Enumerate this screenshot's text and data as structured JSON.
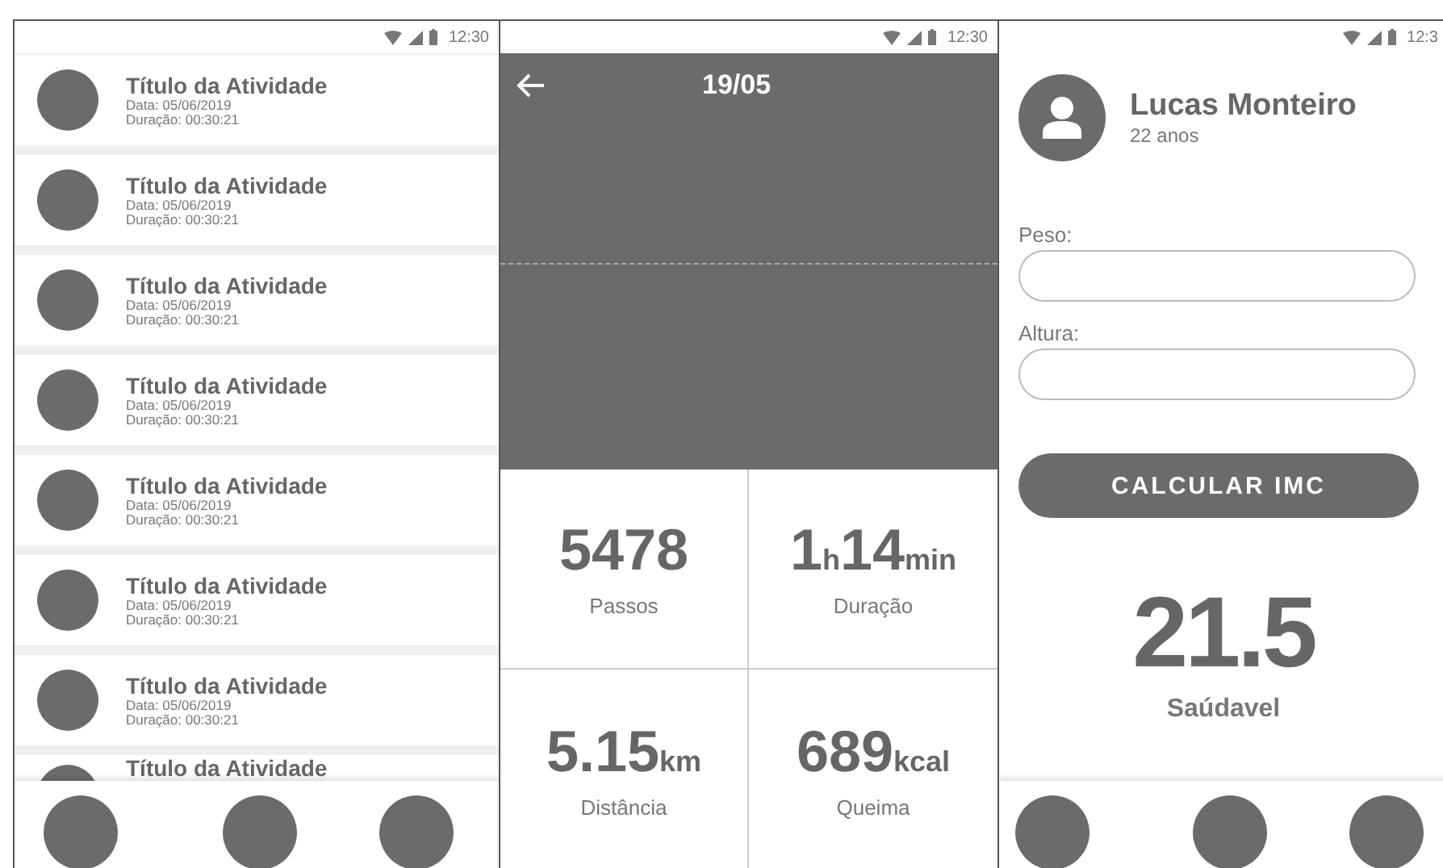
{
  "status_bars": [
    {
      "time": "12:30"
    },
    {
      "time": "12:30"
    },
    {
      "time": "12:3"
    }
  ],
  "activity_list": {
    "items": [
      {
        "title": "Título da Atividade",
        "date": "Data: 05/06/2019",
        "duration": "Duração: 00:30:21"
      },
      {
        "title": "Título da Atividade",
        "date": "Data: 05/06/2019",
        "duration": "Duração: 00:30:21"
      },
      {
        "title": "Título da Atividade",
        "date": "Data: 05/06/2019",
        "duration": "Duração: 00:30:21"
      },
      {
        "title": "Título da Atividade",
        "date": "Data: 05/06/2019",
        "duration": "Duração: 00:30:21"
      },
      {
        "title": "Título da Atividade",
        "date": "Data: 05/06/2019",
        "duration": "Duração: 00:30:21"
      },
      {
        "title": "Título da Atividade",
        "date": "Data: 05/06/2019",
        "duration": "Duração: 00:30:21"
      },
      {
        "title": "Título da Atividade",
        "date": "Data: 05/06/2019",
        "duration": "Duração: 00:30:21"
      },
      {
        "title": "Título da Atividade"
      }
    ]
  },
  "activity_detail": {
    "title": "19/05",
    "stats": [
      {
        "parts": [
          {
            "kind": "number",
            "text": "5478"
          }
        ],
        "label": "Passos"
      },
      {
        "parts": [
          {
            "kind": "number",
            "text": "1"
          },
          {
            "kind": "unit",
            "text": "h"
          },
          {
            "kind": "number",
            "text": "14"
          },
          {
            "kind": "unit",
            "text": "min"
          }
        ],
        "label": "Duração"
      },
      {
        "parts": [
          {
            "kind": "number",
            "text": "5.15"
          },
          {
            "kind": "unit",
            "text": "km"
          }
        ],
        "label": "Distância"
      },
      {
        "parts": [
          {
            "kind": "number",
            "text": "689"
          },
          {
            "kind": "unit",
            "text": "kcal"
          }
        ],
        "label": "Queima"
      }
    ]
  },
  "profile": {
    "name": "Lucas Monteiro",
    "age": "22 anos",
    "fields": [
      {
        "label": "Peso:"
      },
      {
        "label": "Altura:"
      }
    ],
    "button": "CALCULAR IMC",
    "bmi_value": "21.5",
    "bmi_status": "Saúdavel"
  }
}
